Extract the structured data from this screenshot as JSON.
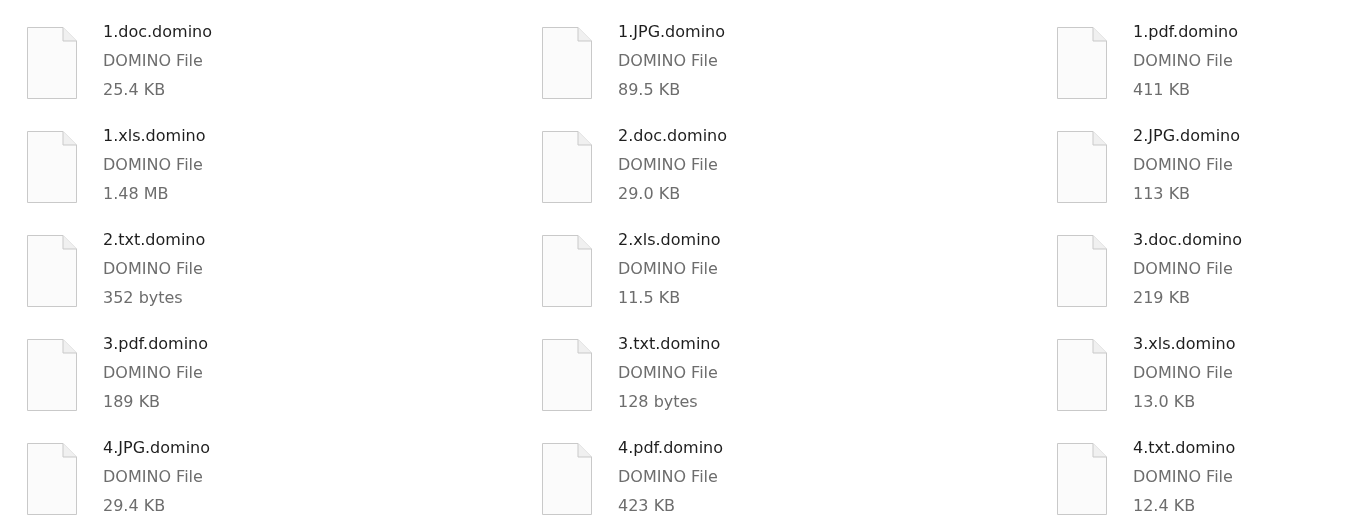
{
  "files": [
    {
      "name": "1.doc.domino",
      "type": "DOMINO File",
      "size": "25.4 KB"
    },
    {
      "name": "1.JPG.domino",
      "type": "DOMINO File",
      "size": "89.5 KB"
    },
    {
      "name": "1.pdf.domino",
      "type": "DOMINO File",
      "size": "411 KB"
    },
    {
      "name": "1.xls.domino",
      "type": "DOMINO File",
      "size": "1.48 MB"
    },
    {
      "name": "2.doc.domino",
      "type": "DOMINO File",
      "size": "29.0 KB"
    },
    {
      "name": "2.JPG.domino",
      "type": "DOMINO File",
      "size": "113 KB"
    },
    {
      "name": "2.txt.domino",
      "type": "DOMINO File",
      "size": "352 bytes"
    },
    {
      "name": "2.xls.domino",
      "type": "DOMINO File",
      "size": "11.5 KB"
    },
    {
      "name": "3.doc.domino",
      "type": "DOMINO File",
      "size": "219 KB"
    },
    {
      "name": "3.pdf.domino",
      "type": "DOMINO File",
      "size": "189 KB"
    },
    {
      "name": "3.txt.domino",
      "type": "DOMINO File",
      "size": "128 bytes"
    },
    {
      "name": "3.xls.domino",
      "type": "DOMINO File",
      "size": "13.0 KB"
    },
    {
      "name": "4.JPG.domino",
      "type": "DOMINO File",
      "size": "29.4 KB"
    },
    {
      "name": "4.pdf.domino",
      "type": "DOMINO File",
      "size": "423 KB"
    },
    {
      "name": "4.txt.domino",
      "type": "DOMINO File",
      "size": "12.4 KB"
    }
  ]
}
